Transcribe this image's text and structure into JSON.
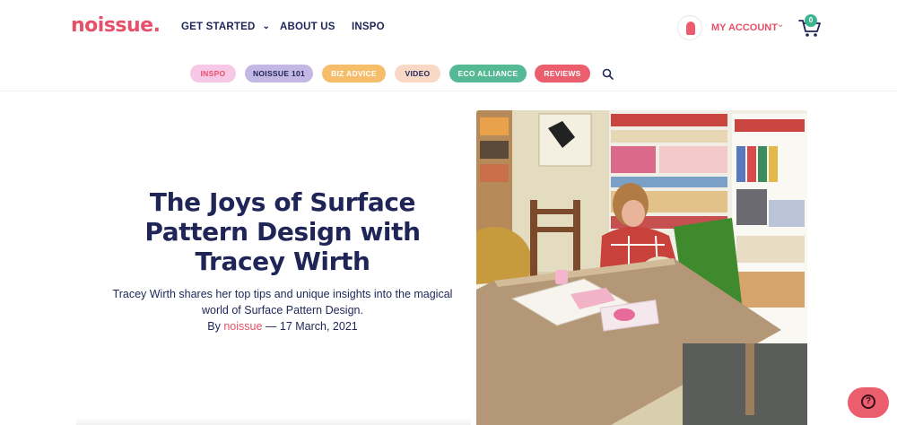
{
  "header": {
    "logo": "noissue.",
    "nav": {
      "get_started": "GET STARTED",
      "about": "ABOUT US",
      "inspo": "INSPO"
    },
    "account_label": "MY ACCOUNT",
    "cart_count": "0"
  },
  "categories": {
    "inspo": "INSPO",
    "noissue101": "NOISSUE 101",
    "biz_advice": "BIZ ADVICE",
    "video": "VIDEO",
    "eco_alliance": "ECO ALLIANCE",
    "reviews": "REVIEWS"
  },
  "article": {
    "title": "The Joys of Surface Pattern Design with Tracey Wirth",
    "description": "Tracey Wirth shares her top tips and unique insights into the magical world of Surface Pattern Design.",
    "by": "By",
    "author": "noissue",
    "date": "— 17 March, 2021"
  },
  "colors": {
    "brand": "#e8506a",
    "navy": "#1f2557",
    "eco_green": "#55b995"
  },
  "icons": [
    "chevron-down-icon",
    "cart-icon",
    "search-icon",
    "help-icon",
    "avatar-icon"
  ]
}
